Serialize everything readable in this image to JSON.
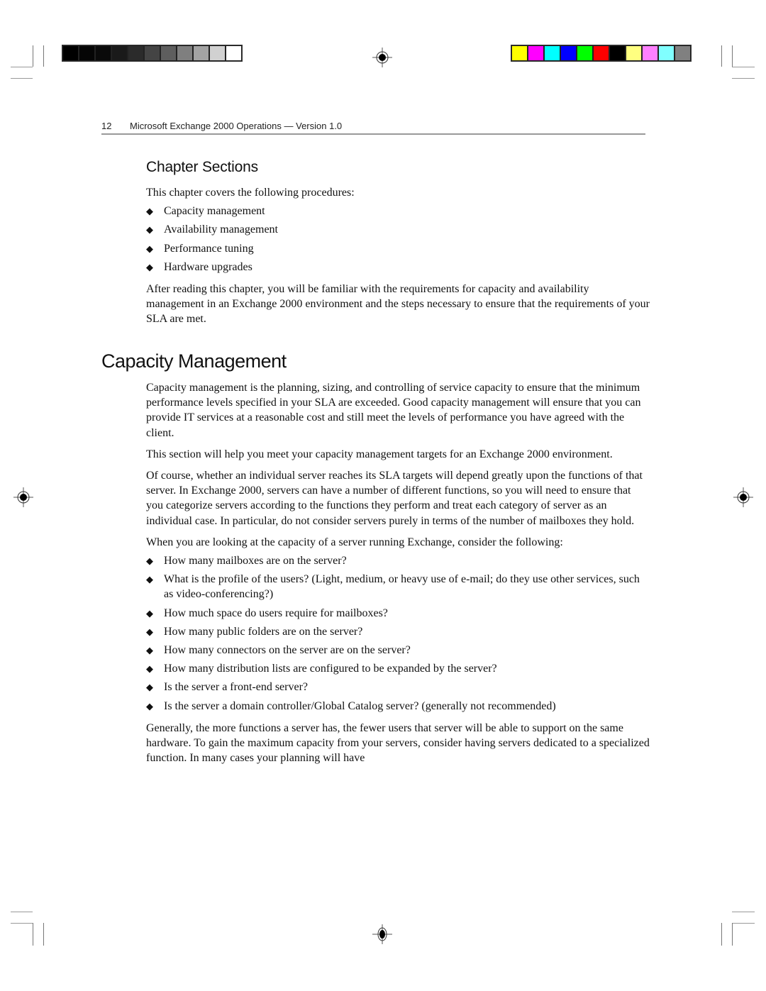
{
  "running_header": {
    "page_number": "12",
    "title": "Microsoft Exchange 2000 Operations — Version 1.0"
  },
  "print_marks": {
    "grayscale_bar": [
      "#000000",
      "#050505",
      "#0a0a0a",
      "#1a1a1a",
      "#2b2b2b",
      "#444444",
      "#5e5e5e",
      "#7f7f7f",
      "#a3a3a3",
      "#d1d1d1",
      "#ffffff"
    ],
    "color_bar": [
      "#ffff00",
      "#ff00ff",
      "#00ffff",
      "#0000ff",
      "#00ff00",
      "#ff0000",
      "#000000",
      "#ffff80",
      "#ff80ff",
      "#80ffff",
      "#808080"
    ],
    "registration_icon": "crosshair-target-icon"
  },
  "chapter_sections": {
    "heading": "Chapter Sections",
    "intro": "This chapter covers the following procedures:",
    "bullet_icon": "diamond-bullet-icon",
    "bullets": [
      "Capacity management",
      "Availability management",
      "Performance tuning",
      "Hardware upgrades"
    ],
    "closing": "After reading this chapter, you will be familiar with the requirements for capacity and availability management in an Exchange 2000 environment and the steps necessary to ensure that the requirements of your SLA are met."
  },
  "capacity_management": {
    "heading": "Capacity Management",
    "paragraphs": [
      "Capacity management is the planning, sizing, and controlling of service capacity to ensure that the minimum performance levels specified in your SLA are exceeded. Good capacity management will ensure that you can provide IT services at a reasonable cost and still meet the levels of performance you have agreed with the client.",
      "This section will help you meet your capacity management targets for an Exchange 2000 environment.",
      "Of course, whether an individual server reaches its SLA targets will depend greatly upon the functions of that server. In Exchange 2000, servers can have a number of different functions, so you will need to ensure that you categorize servers according to the functions they perform and treat each category of server as an individual case. In particular, do not consider servers purely in terms of the number of mailboxes they hold.",
      "When you are looking at the capacity of a server running Exchange, consider the following:"
    ],
    "bullets": [
      "How many mailboxes are on the server?",
      "What is the profile of the users? (Light, medium, or heavy use of e-mail; do they use other services, such as video-conferencing?)",
      "How much space do users require for mailboxes?",
      "How many public folders are on the server?",
      "How many connectors on the server are on the server?",
      "How many distribution lists are configured to be expanded by the server?",
      "Is the server a front-end server?",
      "Is the server a domain controller/Global Catalog server? (generally not recommended)"
    ],
    "closing": "Generally, the more functions a server has, the fewer users that server will be able to support on the same hardware. To gain the maximum capacity from your servers, consider having servers dedicated to a specialized function. In many cases your planning will have"
  }
}
